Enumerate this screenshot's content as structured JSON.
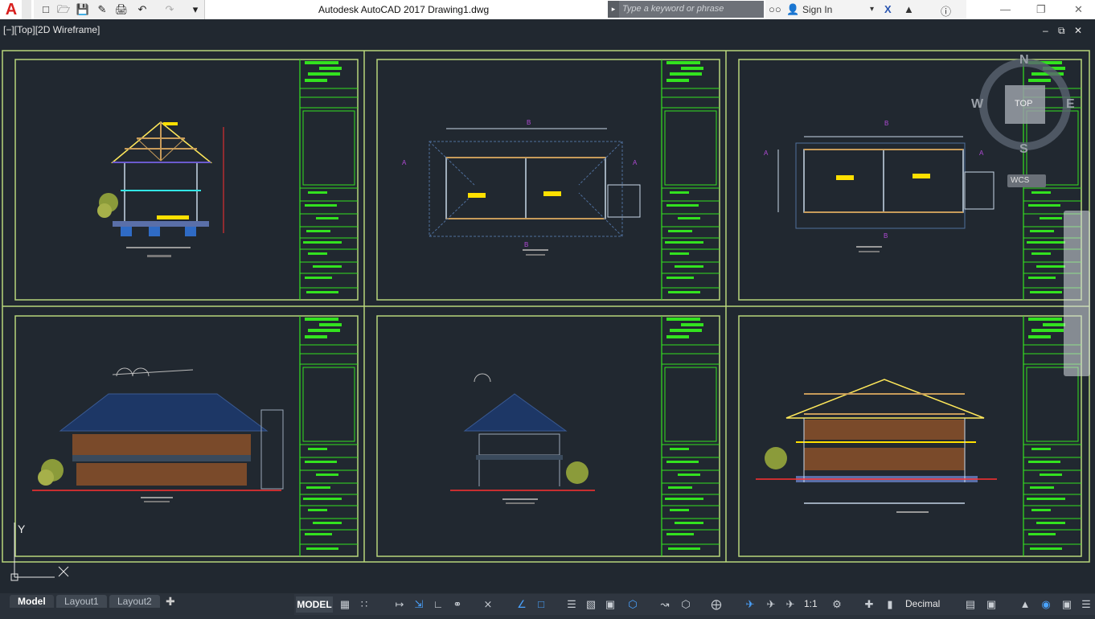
{
  "app": {
    "title": "Autodesk AutoCAD 2017    Drawing1.dwg",
    "logo_letter": "A"
  },
  "search": {
    "placeholder": "Type a keyword or phrase"
  },
  "user": {
    "sign_in": "Sign In"
  },
  "viewport": {
    "label": "[−][Top][2D Wireframe]",
    "controls": [
      "‒",
      "⧉",
      "✕"
    ]
  },
  "viewcube": {
    "north": "N",
    "south": "S",
    "east": "E",
    "west": "W",
    "face": "TOP",
    "wcs": "WCS"
  },
  "ucs": {
    "y_label": "Y"
  },
  "tabs": [
    {
      "label": "Model",
      "active": true
    },
    {
      "label": "Layout1",
      "active": false
    },
    {
      "label": "Layout2",
      "active": false
    }
  ],
  "status": {
    "model": "MODEL",
    "scale": "1:1",
    "units": "Decimal"
  },
  "colors": {
    "sheet_border": "#b7d67a",
    "title_block": "#33e21f",
    "background": "#212830"
  }
}
